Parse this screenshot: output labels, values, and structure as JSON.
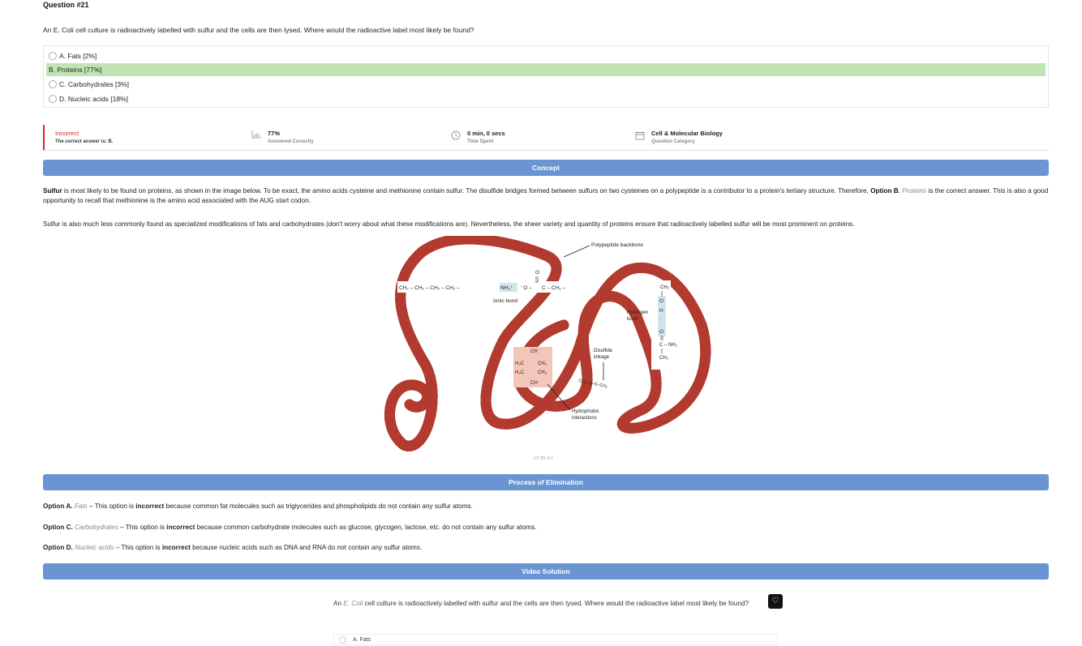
{
  "question": {
    "number": "Question #21",
    "text": "An E. Coli cell culture is radioactively labelled with sulfur and the cells are then lysed. Where would the radioactive label most likely be found?",
    "options": [
      {
        "label": "A. Fats [2%]",
        "correct": false
      },
      {
        "label": "B. Proteins [77%]",
        "correct": true
      },
      {
        "label": "C. Carbohydrates [3%]",
        "correct": false
      },
      {
        "label": "D. Nucleic acids [18%]",
        "correct": false
      }
    ]
  },
  "stats": {
    "result": "Incorrect",
    "correct_answer": "The correct answer is: B.",
    "percent": "77%",
    "percent_label": "Answered Correctly",
    "time": "0 min, 0 secs",
    "time_label": "Time Spent",
    "category": "Cell & Molecular Biology",
    "category_label": "Question Category",
    "icons": [
      "bar-chart-icon",
      "clock-icon",
      "calendar-icon"
    ]
  },
  "sections": {
    "concept": "Concept",
    "elimination": "Process of Elimination",
    "video": "Video Solution"
  },
  "concept": {
    "p1_bold": "Sulfur",
    "p1_a": " is most likely to be found on proteins, as shown in the image below. To be exact, the amino acids cysteine and methionine contain sulfur. The disulfide bridges formed between sulfurs on two cysteines on a polypeptide is a contributor to a protein's tertiary structure. Therefore, ",
    "p1_option": "Option B",
    "p1_dot": ". ",
    "p1_italic": "Proteins",
    "p1_b": " is the correct answer. This is also a good opportunity to recall that methionine is the amino acid associated with the AUG start codon.",
    "p2": "Sulfur is also much less commonly found as specialized modifications of fats and carbohydrates (don't worry about what these modifications are). Nevertheless, the sheer variety and quantity of proteins ensure that radioactively labelled sulfur will be most prominent on proteins."
  },
  "figure": {
    "backbone": "Polypeptide backbone",
    "chain": "CH₂ – CH₂ – CH₂ – CH₂ –",
    "nh3": "NH₃⁺",
    "o_minus": "⁻O –",
    "c_ch2": "C – CH₂ –",
    "o_top": "O",
    "ionic": "Ionic bond",
    "hydrogen": "Hydrogen",
    "bond": "bond",
    "ch2_top": "CH₂",
    "o1": "O",
    "h": "H",
    "o2": "O",
    "c_nh2": "C – NH₂",
    "ch2_bottom": "CH₂",
    "disulfide": "Disulfide",
    "linkage": "linkage",
    "ss": "CH₂–S–S–CH₂",
    "hydrophobic": "Hydrophobic",
    "interactions": "interactions",
    "ch_top": "CH",
    "h3c1": "H₃C",
    "ch3_1": "CH₃",
    "h3c2": "H₃C",
    "ch3_2": "CH₃",
    "ch_bot": "CH",
    "credit": "CC BY 4.0"
  },
  "elimination": [
    {
      "opt": "Option A.",
      "name": "Fats",
      "a": " – This option is ",
      "b": "incorrect",
      "c": " because common fat molecules such as triglycerides and phospholipids do not contain any sulfur atoms."
    },
    {
      "opt": "Option C.",
      "name": "Carbohydrates",
      "a": " – This option is ",
      "b": "incorrect",
      "c": " because common carbohydrate molecules such as glucose, glycogen, lactose, etc. do not contain any sulfur atoms."
    },
    {
      "opt": "Option D.",
      "name": "Nucleic acids",
      "a": " – This option is ",
      "b": "incorrect",
      "c": " because nucleic acids such as DNA and RNA do not contain any sulfur atoms."
    }
  ],
  "video": {
    "q_a": "An ",
    "q_ecoli": "E. Coli",
    "q_b": " cell culture is radioactively labelled with sulfur and the cells are then lysed. Where would the radioactive label most likely be found?",
    "option": "A. Fats"
  },
  "colors": {
    "accent": "#6a95d2",
    "correct_bg": "#c2e4b4",
    "incorrect": "#d9251c",
    "backbone": "#e8786a"
  }
}
